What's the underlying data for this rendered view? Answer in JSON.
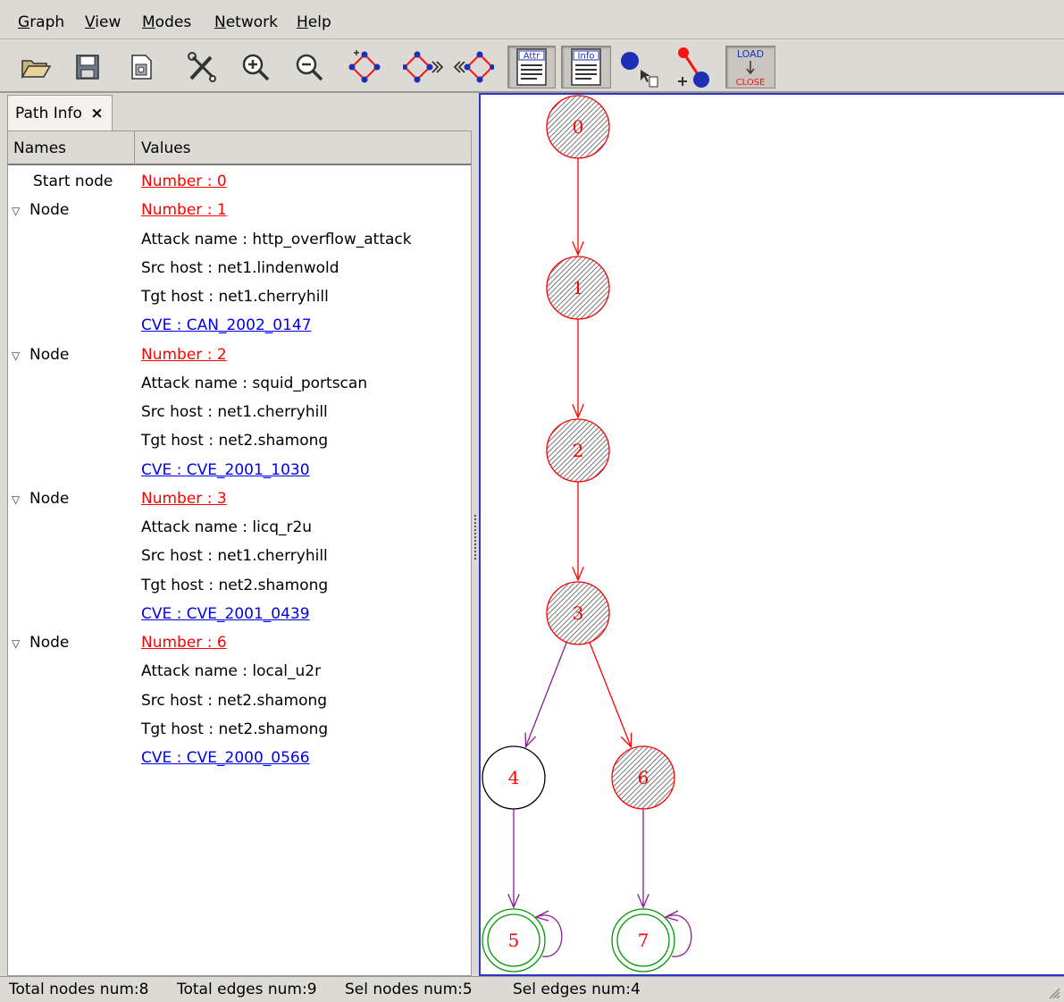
{
  "menu": [
    {
      "accel": "G",
      "rest": "raph"
    },
    {
      "accel": "V",
      "rest": "iew"
    },
    {
      "accel": "M",
      "rest": "odes"
    },
    {
      "accel": "N",
      "rest": "etwork"
    },
    {
      "accel": "H",
      "rest": "elp"
    }
  ],
  "toolbar": {
    "attr_label": "Attr",
    "info_label": "Info",
    "load_label": "LOAD",
    "close_label": "CLOSE",
    "icons": [
      "open-folder-icon",
      "save-icon",
      "properties-icon",
      "tools-icon",
      "zoom-in-icon",
      "zoom-out-icon",
      "layout-diamond-icon",
      "expand-forward-icon",
      "expand-backward-icon",
      "attr-panel-icon",
      "info-panel-icon",
      "node-select-icon",
      "path-add-icon",
      "load-close-icon"
    ]
  },
  "panel": {
    "tab_label": "Path Info",
    "tab_close": "×",
    "col_names": "Names",
    "col_values": "Values"
  },
  "tree": [
    {
      "name": "Start node",
      "value": "Number : 0",
      "kind": "red",
      "expander": false
    },
    {
      "name": "Node",
      "value": "Number : 1",
      "kind": "red",
      "expander": true
    },
    {
      "name": "",
      "value": "Attack name : http_overflow_attack",
      "kind": "plain",
      "expander": false
    },
    {
      "name": "",
      "value": "Src host : net1.lindenwold",
      "kind": "plain",
      "expander": false
    },
    {
      "name": "",
      "value": "Tgt host : net1.cherryhill",
      "kind": "plain",
      "expander": false
    },
    {
      "name": "",
      "value": "CVE : CAN_2002_0147",
      "kind": "blue",
      "expander": false
    },
    {
      "name": "Node",
      "value": "Number : 2",
      "kind": "red",
      "expander": true
    },
    {
      "name": "",
      "value": "Attack name : squid_portscan",
      "kind": "plain",
      "expander": false
    },
    {
      "name": "",
      "value": "Src host : net1.cherryhill",
      "kind": "plain",
      "expander": false
    },
    {
      "name": "",
      "value": "Tgt host : net2.shamong",
      "kind": "plain",
      "expander": false
    },
    {
      "name": "",
      "value": "CVE : CVE_2001_1030",
      "kind": "blue",
      "expander": false
    },
    {
      "name": "Node",
      "value": "Number : 3",
      "kind": "red",
      "expander": true
    },
    {
      "name": "",
      "value": "Attack name : licq_r2u",
      "kind": "plain",
      "expander": false
    },
    {
      "name": "",
      "value": "Src host : net1.cherryhill",
      "kind": "plain",
      "expander": false
    },
    {
      "name": "",
      "value": "Tgt host : net2.shamong",
      "kind": "plain",
      "expander": false
    },
    {
      "name": "",
      "value": "CVE : CVE_2001_0439",
      "kind": "blue",
      "expander": false
    },
    {
      "name": "Node",
      "value": "Number : 6",
      "kind": "red",
      "expander": true
    },
    {
      "name": "",
      "value": "Attack name : local_u2r",
      "kind": "plain",
      "expander": false
    },
    {
      "name": "",
      "value": "Src host : net2.shamong",
      "kind": "plain",
      "expander": false
    },
    {
      "name": "",
      "value": "Tgt host : net2.shamong",
      "kind": "plain",
      "expander": false
    },
    {
      "name": "",
      "value": "CVE : CVE_2000_0566",
      "kind": "blue",
      "expander": false
    }
  ],
  "graph": {
    "nodes": [
      {
        "id": "0",
        "style": "hatched"
      },
      {
        "id": "1",
        "style": "hatched"
      },
      {
        "id": "2",
        "style": "hatched"
      },
      {
        "id": "3",
        "style": "hatched"
      },
      {
        "id": "4",
        "style": "plain"
      },
      {
        "id": "6",
        "style": "hatched"
      },
      {
        "id": "5",
        "style": "final"
      },
      {
        "id": "7",
        "style": "final"
      }
    ],
    "edges": [
      {
        "from": "0",
        "to": "1",
        "color": "red"
      },
      {
        "from": "1",
        "to": "2",
        "color": "red"
      },
      {
        "from": "2",
        "to": "3",
        "color": "red"
      },
      {
        "from": "3",
        "to": "4",
        "color": "purple"
      },
      {
        "from": "3",
        "to": "6",
        "color": "red"
      },
      {
        "from": "4",
        "to": "5",
        "color": "purple"
      },
      {
        "from": "6",
        "to": "7",
        "color": "purple"
      },
      {
        "from": "5",
        "to": "5",
        "color": "purple"
      },
      {
        "from": "7",
        "to": "7",
        "color": "purple"
      }
    ]
  },
  "status": {
    "total_nodes": "Total nodes num:8",
    "total_edges": "Total edges num:9",
    "sel_nodes": "Sel nodes num:5",
    "sel_edges": "Sel edges num:4"
  },
  "colors": {
    "selected_node": "#ff0000",
    "final_node": "#009900",
    "edge_purple": "#8b1a9b",
    "edge_red": "#ff0000",
    "link_blue": "#0000ee"
  }
}
